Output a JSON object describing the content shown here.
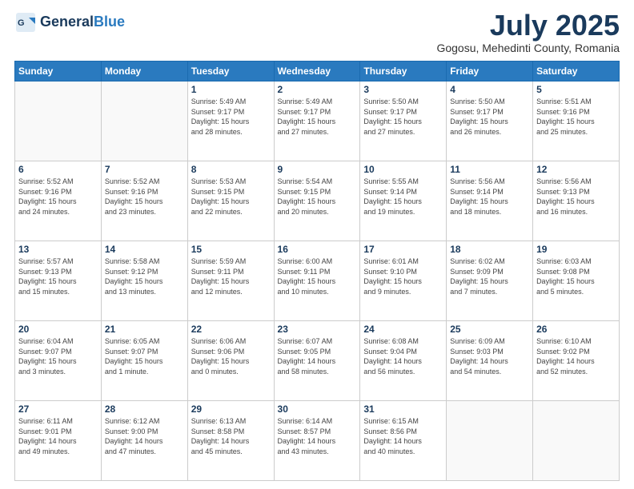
{
  "header": {
    "logo_line1": "General",
    "logo_line2": "Blue",
    "month": "July 2025",
    "location": "Gogosu, Mehedinti County, Romania"
  },
  "days_of_week": [
    "Sunday",
    "Monday",
    "Tuesday",
    "Wednesday",
    "Thursday",
    "Friday",
    "Saturday"
  ],
  "weeks": [
    [
      {
        "num": "",
        "detail": ""
      },
      {
        "num": "",
        "detail": ""
      },
      {
        "num": "1",
        "detail": "Sunrise: 5:49 AM\nSunset: 9:17 PM\nDaylight: 15 hours\nand 28 minutes."
      },
      {
        "num": "2",
        "detail": "Sunrise: 5:49 AM\nSunset: 9:17 PM\nDaylight: 15 hours\nand 27 minutes."
      },
      {
        "num": "3",
        "detail": "Sunrise: 5:50 AM\nSunset: 9:17 PM\nDaylight: 15 hours\nand 27 minutes."
      },
      {
        "num": "4",
        "detail": "Sunrise: 5:50 AM\nSunset: 9:17 PM\nDaylight: 15 hours\nand 26 minutes."
      },
      {
        "num": "5",
        "detail": "Sunrise: 5:51 AM\nSunset: 9:16 PM\nDaylight: 15 hours\nand 25 minutes."
      }
    ],
    [
      {
        "num": "6",
        "detail": "Sunrise: 5:52 AM\nSunset: 9:16 PM\nDaylight: 15 hours\nand 24 minutes."
      },
      {
        "num": "7",
        "detail": "Sunrise: 5:52 AM\nSunset: 9:16 PM\nDaylight: 15 hours\nand 23 minutes."
      },
      {
        "num": "8",
        "detail": "Sunrise: 5:53 AM\nSunset: 9:15 PM\nDaylight: 15 hours\nand 22 minutes."
      },
      {
        "num": "9",
        "detail": "Sunrise: 5:54 AM\nSunset: 9:15 PM\nDaylight: 15 hours\nand 20 minutes."
      },
      {
        "num": "10",
        "detail": "Sunrise: 5:55 AM\nSunset: 9:14 PM\nDaylight: 15 hours\nand 19 minutes."
      },
      {
        "num": "11",
        "detail": "Sunrise: 5:56 AM\nSunset: 9:14 PM\nDaylight: 15 hours\nand 18 minutes."
      },
      {
        "num": "12",
        "detail": "Sunrise: 5:56 AM\nSunset: 9:13 PM\nDaylight: 15 hours\nand 16 minutes."
      }
    ],
    [
      {
        "num": "13",
        "detail": "Sunrise: 5:57 AM\nSunset: 9:13 PM\nDaylight: 15 hours\nand 15 minutes."
      },
      {
        "num": "14",
        "detail": "Sunrise: 5:58 AM\nSunset: 9:12 PM\nDaylight: 15 hours\nand 13 minutes."
      },
      {
        "num": "15",
        "detail": "Sunrise: 5:59 AM\nSunset: 9:11 PM\nDaylight: 15 hours\nand 12 minutes."
      },
      {
        "num": "16",
        "detail": "Sunrise: 6:00 AM\nSunset: 9:11 PM\nDaylight: 15 hours\nand 10 minutes."
      },
      {
        "num": "17",
        "detail": "Sunrise: 6:01 AM\nSunset: 9:10 PM\nDaylight: 15 hours\nand 9 minutes."
      },
      {
        "num": "18",
        "detail": "Sunrise: 6:02 AM\nSunset: 9:09 PM\nDaylight: 15 hours\nand 7 minutes."
      },
      {
        "num": "19",
        "detail": "Sunrise: 6:03 AM\nSunset: 9:08 PM\nDaylight: 15 hours\nand 5 minutes."
      }
    ],
    [
      {
        "num": "20",
        "detail": "Sunrise: 6:04 AM\nSunset: 9:07 PM\nDaylight: 15 hours\nand 3 minutes."
      },
      {
        "num": "21",
        "detail": "Sunrise: 6:05 AM\nSunset: 9:07 PM\nDaylight: 15 hours\nand 1 minute."
      },
      {
        "num": "22",
        "detail": "Sunrise: 6:06 AM\nSunset: 9:06 PM\nDaylight: 15 hours\nand 0 minutes."
      },
      {
        "num": "23",
        "detail": "Sunrise: 6:07 AM\nSunset: 9:05 PM\nDaylight: 14 hours\nand 58 minutes."
      },
      {
        "num": "24",
        "detail": "Sunrise: 6:08 AM\nSunset: 9:04 PM\nDaylight: 14 hours\nand 56 minutes."
      },
      {
        "num": "25",
        "detail": "Sunrise: 6:09 AM\nSunset: 9:03 PM\nDaylight: 14 hours\nand 54 minutes."
      },
      {
        "num": "26",
        "detail": "Sunrise: 6:10 AM\nSunset: 9:02 PM\nDaylight: 14 hours\nand 52 minutes."
      }
    ],
    [
      {
        "num": "27",
        "detail": "Sunrise: 6:11 AM\nSunset: 9:01 PM\nDaylight: 14 hours\nand 49 minutes."
      },
      {
        "num": "28",
        "detail": "Sunrise: 6:12 AM\nSunset: 9:00 PM\nDaylight: 14 hours\nand 47 minutes."
      },
      {
        "num": "29",
        "detail": "Sunrise: 6:13 AM\nSunset: 8:58 PM\nDaylight: 14 hours\nand 45 minutes."
      },
      {
        "num": "30",
        "detail": "Sunrise: 6:14 AM\nSunset: 8:57 PM\nDaylight: 14 hours\nand 43 minutes."
      },
      {
        "num": "31",
        "detail": "Sunrise: 6:15 AM\nSunset: 8:56 PM\nDaylight: 14 hours\nand 40 minutes."
      },
      {
        "num": "",
        "detail": ""
      },
      {
        "num": "",
        "detail": ""
      }
    ]
  ]
}
